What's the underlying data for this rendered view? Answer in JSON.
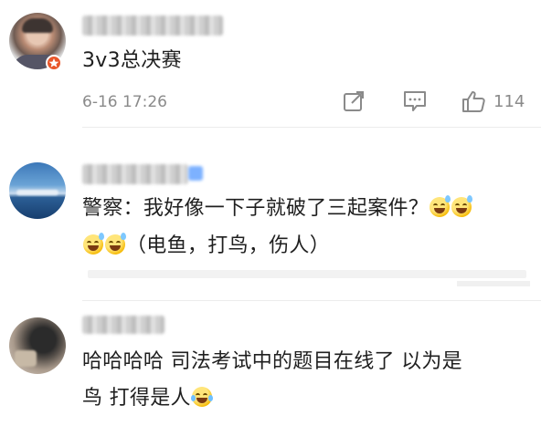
{
  "comments": [
    {
      "text": "3v3总决赛",
      "timestamp": "6-16 17:26",
      "like_count": "114",
      "icons": [
        "share-icon",
        "reply-icon",
        "like-icon"
      ]
    },
    {
      "text_line1": "警察：我好像一下子就破了三起案件？",
      "text_line2": "（电鱼，打鸟，伤人）"
    },
    {
      "text_line1": "哈哈哈哈 司法考试中的题目在线了 以为是",
      "text_line2": "鸟 打得是人"
    }
  ],
  "colors": {
    "text": "#1f1f1f",
    "meta": "#8a8a8a",
    "badge": "#e8562a",
    "divider": "#ececec"
  }
}
